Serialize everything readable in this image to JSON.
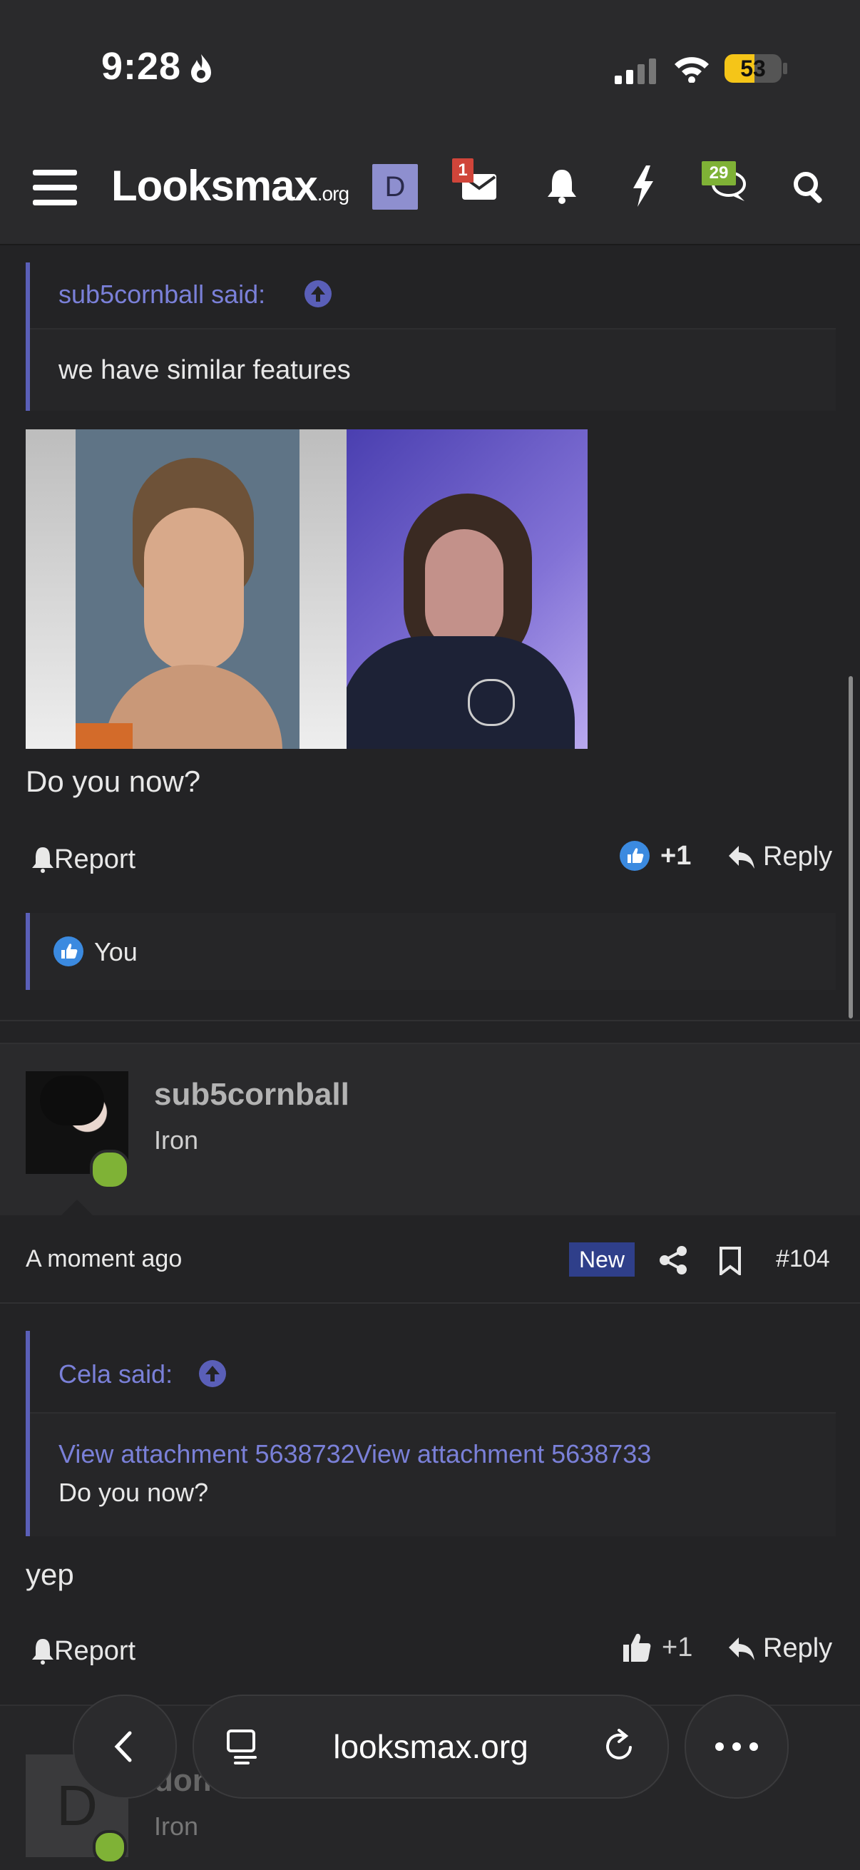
{
  "status_bar": {
    "time": "9:28",
    "battery": "53",
    "battery_level": 0.53
  },
  "header": {
    "logo_main": "Looksmax",
    "logo_suffix": ".org",
    "user_initial": "D",
    "inbox_badge": "1",
    "chat_badge": "29"
  },
  "post1": {
    "quote_author": "sub5cornball said:",
    "quote_text": "we have similar features",
    "body": "Do you now?",
    "report_label": "Report",
    "reaction_count": "+1",
    "reply_label": "Reply",
    "reactions_by": "You"
  },
  "post2": {
    "username": "sub5cornball",
    "rank": "Iron",
    "timestamp": "A moment ago",
    "new_badge": "New",
    "post_number": "#104",
    "quote_author": "Cela said:",
    "quote_link_1": "View attachment 5638732",
    "quote_link_2": "View attachment 5638733",
    "quote_text": "Do you now?",
    "body": "yep",
    "report_label": "Report",
    "reaction_count": "+1",
    "reply_label": "Reply"
  },
  "post3": {
    "avatar_initial": "D",
    "username_partial": "don",
    "rank": "Iron"
  },
  "browser_bar": {
    "url": "looksmax.org"
  },
  "colors": {
    "accent": "#7a80d8",
    "background": "#232325",
    "online": "#7fb236",
    "new_badge": "#2f3f8a"
  }
}
